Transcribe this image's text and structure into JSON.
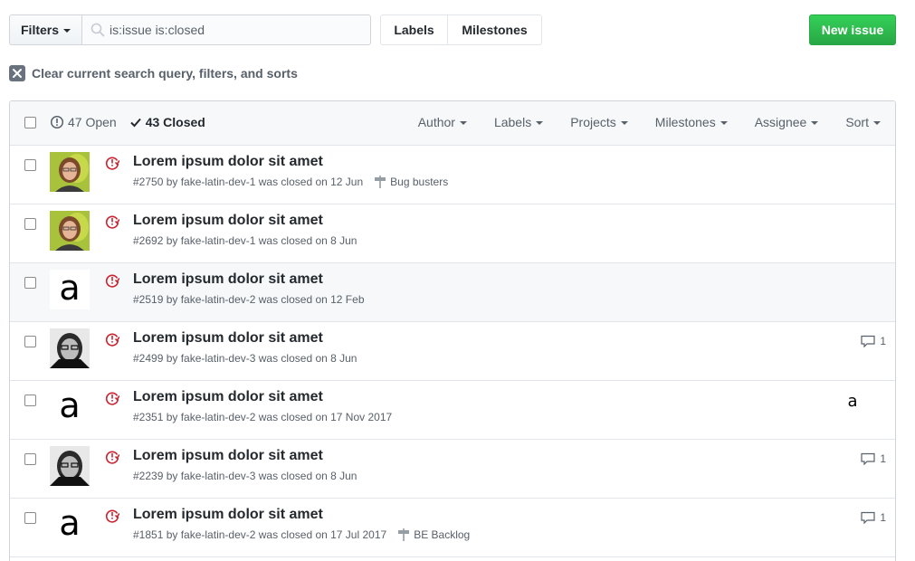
{
  "toolbar": {
    "filters_label": "Filters",
    "search_value": "is:issue is:closed",
    "labels_label": "Labels",
    "milestones_label": "Milestones",
    "new_issue_label": "New issue"
  },
  "clear_search": {
    "label": "Clear current search query, filters, and sorts"
  },
  "list_header": {
    "open_label": "47 Open",
    "closed_label": "43 Closed",
    "filters": [
      "Author",
      "Labels",
      "Projects",
      "Milestones",
      "Assignee",
      "Sort"
    ]
  },
  "issues": [
    {
      "title": "Lorem ipsum dolor sit amet",
      "meta": "#2750 by fake-latin-dev-1 was closed on 12 Jun",
      "milestone": "Bug busters",
      "comments": "",
      "avatar": "woman-photo"
    },
    {
      "title": "Lorem ipsum dolor sit amet",
      "meta": "#2692 by fake-latin-dev-1 was closed on 8 Jun",
      "milestone": "",
      "comments": "",
      "avatar": "woman-photo"
    },
    {
      "title": "Lorem ipsum dolor sit amet",
      "meta": "#2519 by fake-latin-dev-2 was closed on 12 Feb",
      "milestone": "",
      "comments": "",
      "avatar": "letter-a"
    },
    {
      "title": "Lorem ipsum dolor sit amet",
      "meta": "#2499 by fake-latin-dev-3 was closed on 8 Jun",
      "milestone": "",
      "comments": "1",
      "avatar": "man-photo"
    },
    {
      "title": "Lorem ipsum dolor sit amet",
      "meta": "#2351 by fake-latin-dev-2 was closed on 17 Nov 2017",
      "milestone": "",
      "comments": "",
      "avatar": "letter-a",
      "assignee": "a"
    },
    {
      "title": "Lorem ipsum dolor sit amet",
      "meta": "#2239 by fake-latin-dev-3 was closed on 8 Jun",
      "milestone": "",
      "comments": "1",
      "avatar": "man-photo"
    },
    {
      "title": "Lorem ipsum dolor sit amet",
      "meta": "#1851 by fake-latin-dev-2 was closed on 17 Jul 2017",
      "milestone": "BE Backlog",
      "comments": "1",
      "avatar": "letter-a"
    }
  ],
  "avatar_letter": "a",
  "colors": {
    "accent_green": "#28a745",
    "closed_red": "#cb2431",
    "text": "#24292e",
    "muted": "#586069"
  }
}
